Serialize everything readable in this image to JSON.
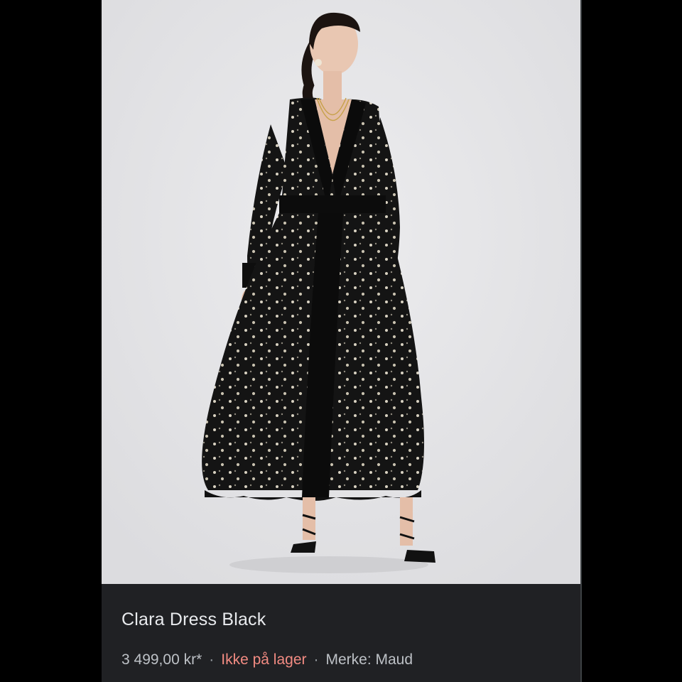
{
  "product": {
    "image_alt": "Model wearing black long-sleeve maxi dress with metallic dots",
    "title": "Clara Dress Black",
    "price": "3 499,00 kr*",
    "separator": "·",
    "stock_status": "Ikke på lager",
    "brand": "Merke: Maud"
  },
  "colors": {
    "card_background": "#202124",
    "photo_background": "#e5e5e7",
    "title_text": "#e8eaed",
    "meta_text": "#bdc1c6",
    "stock_text": "#f28b82"
  }
}
